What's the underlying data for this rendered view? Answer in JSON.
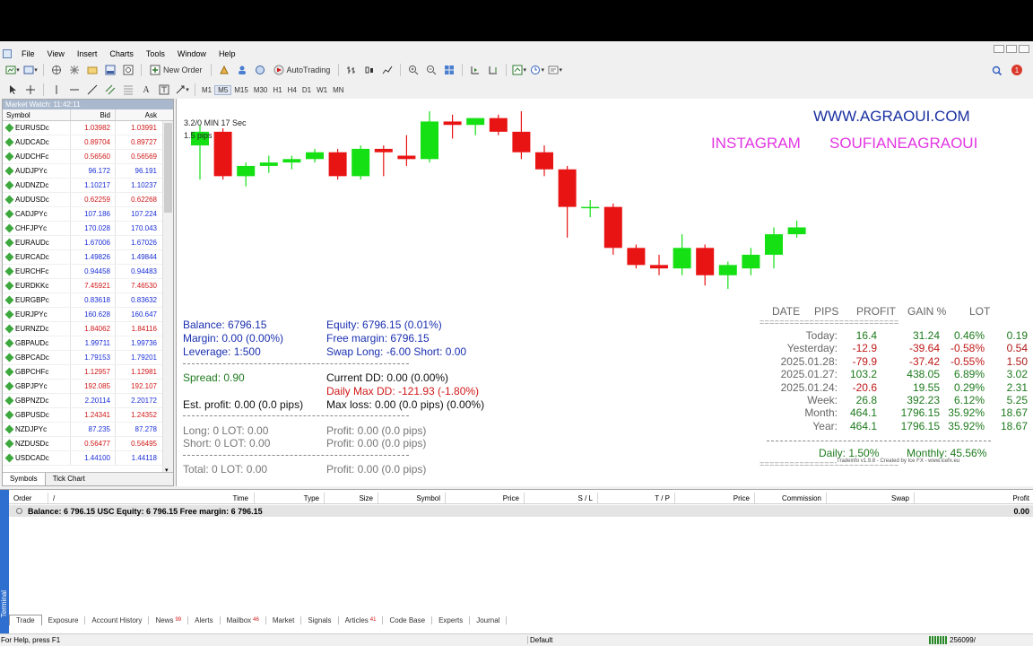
{
  "menu": [
    "File",
    "View",
    "Insert",
    "Charts",
    "Tools",
    "Window",
    "Help"
  ],
  "toolbar": {
    "new_order": "New Order",
    "auto_trading": "AutoTrading",
    "timeframes": [
      "M1",
      "M5",
      "M15",
      "M30",
      "H1",
      "H4",
      "D1",
      "W1",
      "MN"
    ],
    "notification_count": "1"
  },
  "market_watch": {
    "title": "Market Watch: 11:42:11",
    "headers": [
      "Symbol",
      "Bid",
      "Ask"
    ],
    "rows": [
      {
        "symbol": "EURUSDc",
        "bid": "1.03982",
        "ask": "1.03991",
        "dir": "up"
      },
      {
        "symbol": "AUDCADc",
        "bid": "0.89704",
        "ask": "0.89727",
        "dir": "up"
      },
      {
        "symbol": "AUDCHFc",
        "bid": "0.56560",
        "ask": "0.56569",
        "dir": "up"
      },
      {
        "symbol": "AUDJPYc",
        "bid": "96.172",
        "ask": "96.191",
        "dir": "dn"
      },
      {
        "symbol": "AUDNZDc",
        "bid": "1.10217",
        "ask": "1.10237",
        "dir": "dn"
      },
      {
        "symbol": "AUDUSDc",
        "bid": "0.62259",
        "ask": "0.62268",
        "dir": "up"
      },
      {
        "symbol": "CADJPYc",
        "bid": "107.186",
        "ask": "107.224",
        "dir": "dn"
      },
      {
        "symbol": "CHFJPYc",
        "bid": "170.028",
        "ask": "170.043",
        "dir": "dn"
      },
      {
        "symbol": "EURAUDc",
        "bid": "1.67006",
        "ask": "1.67026",
        "dir": "dn"
      },
      {
        "symbol": "EURCADc",
        "bid": "1.49826",
        "ask": "1.49844",
        "dir": "dn"
      },
      {
        "symbol": "EURCHFc",
        "bid": "0.94458",
        "ask": "0.94483",
        "dir": "dn"
      },
      {
        "symbol": "EURDKKc",
        "bid": "7.45921",
        "ask": "7.46530",
        "dir": "up"
      },
      {
        "symbol": "EURGBPc",
        "bid": "0.83618",
        "ask": "0.83632",
        "dir": "dn"
      },
      {
        "symbol": "EURJPYc",
        "bid": "160.628",
        "ask": "160.647",
        "dir": "dn"
      },
      {
        "symbol": "EURNZDc",
        "bid": "1.84062",
        "ask": "1.84116",
        "dir": "up"
      },
      {
        "symbol": "GBPAUDc",
        "bid": "1.99711",
        "ask": "1.99736",
        "dir": "dn"
      },
      {
        "symbol": "GBPCADc",
        "bid": "1.79153",
        "ask": "1.79201",
        "dir": "dn"
      },
      {
        "symbol": "GBPCHFc",
        "bid": "1.12957",
        "ask": "1.12981",
        "dir": "up"
      },
      {
        "symbol": "GBPJPYc",
        "bid": "192.085",
        "ask": "192.107",
        "dir": "up"
      },
      {
        "symbol": "GBPNZDc",
        "bid": "2.20114",
        "ask": "2.20172",
        "dir": "dn"
      },
      {
        "symbol": "GBPUSDc",
        "bid": "1.24341",
        "ask": "1.24352",
        "dir": "up"
      },
      {
        "symbol": "NZDJPYc",
        "bid": "87.235",
        "ask": "87.278",
        "dir": "dn"
      },
      {
        "symbol": "NZDUSDc",
        "bid": "0.56477",
        "ask": "0.56495",
        "dir": "up"
      },
      {
        "symbol": "USDCADc",
        "bid": "1.44100",
        "ask": "1.44118",
        "dir": "dn"
      }
    ],
    "tabs": [
      "Symbols",
      "Tick Chart"
    ]
  },
  "chart": {
    "timer_line1": "3.2/0 MIN 17 Sec",
    "timer_line2": "1.5 pips",
    "website": "WWW.AGRAOUI.COM",
    "instagram_label": "INSTAGRAM",
    "instagram_handle": "SOUFIANEAGRAOUI",
    "colors": {
      "bull": "#14e014",
      "bear": "#e81414"
    },
    "candles": [
      {
        "o": 1.0402,
        "h": 1.0408,
        "l": 1.0392,
        "c": 1.0406
      },
      {
        "o": 1.0406,
        "h": 1.0407,
        "l": 1.0392,
        "c": 1.0393
      },
      {
        "o": 1.0393,
        "h": 1.0397,
        "l": 1.039,
        "c": 1.0396
      },
      {
        "o": 1.0396,
        "h": 1.0399,
        "l": 1.0394,
        "c": 1.0397
      },
      {
        "o": 1.0397,
        "h": 1.0399,
        "l": 1.0395,
        "c": 1.0398
      },
      {
        "o": 1.0398,
        "h": 1.0401,
        "l": 1.0397,
        "c": 1.04
      },
      {
        "o": 1.04,
        "h": 1.0401,
        "l": 1.0392,
        "c": 1.0393
      },
      {
        "o": 1.0393,
        "h": 1.0402,
        "l": 1.0392,
        "c": 1.0401
      },
      {
        "o": 1.0401,
        "h": 1.0402,
        "l": 1.0393,
        "c": 1.04
      },
      {
        "o": 1.0399,
        "h": 1.0405,
        "l": 1.0396,
        "c": 1.0398
      },
      {
        "o": 1.0398,
        "h": 1.0412,
        "l": 1.0397,
        "c": 1.0409
      },
      {
        "o": 1.0409,
        "h": 1.0411,
        "l": 1.0404,
        "c": 1.0408
      },
      {
        "o": 1.0408,
        "h": 1.041,
        "l": 1.0405,
        "c": 1.041
      },
      {
        "o": 1.041,
        "h": 1.0411,
        "l": 1.0405,
        "c": 1.0406
      },
      {
        "o": 1.0406,
        "h": 1.0412,
        "l": 1.0398,
        "c": 1.04
      },
      {
        "o": 1.04,
        "h": 1.0402,
        "l": 1.0393,
        "c": 1.0395
      },
      {
        "o": 1.0395,
        "h": 1.0396,
        "l": 1.0375,
        "c": 1.0384
      },
      {
        "o": 1.0384,
        "h": 1.0386,
        "l": 1.0381,
        "c": 1.0384
      },
      {
        "o": 1.0384,
        "h": 1.0385,
        "l": 1.037,
        "c": 1.0372
      },
      {
        "o": 1.0372,
        "h": 1.0373,
        "l": 1.0366,
        "c": 1.0367
      },
      {
        "o": 1.0367,
        "h": 1.037,
        "l": 1.0364,
        "c": 1.0366
      },
      {
        "o": 1.0366,
        "h": 1.0376,
        "l": 1.0364,
        "c": 1.0372
      },
      {
        "o": 1.0372,
        "h": 1.0373,
        "l": 1.0361,
        "c": 1.0364
      },
      {
        "o": 1.0364,
        "h": 1.0368,
        "l": 1.036,
        "c": 1.0367
      },
      {
        "o": 1.0366,
        "h": 1.0372,
        "l": 1.0364,
        "c": 1.037
      },
      {
        "o": 1.037,
        "h": 1.0378,
        "l": 1.0366,
        "c": 1.0376
      },
      {
        "o": 1.0376,
        "h": 1.038,
        "l": 1.0375,
        "c": 1.0378
      }
    ],
    "account": {
      "balance": "Balance:  6796.15",
      "margin": "Margin: 0.00  (0.00%)",
      "leverage": "Leverage: 1:500",
      "equity": "Equity:  6796.15  (0.01%)",
      "free_margin": "Free margin: 6796.15",
      "swap": "Swap  Long: -6.00  Short: 0.00",
      "spread": "Spread: 0.90",
      "current_dd": "Current    DD: 0.00   (0.00%)",
      "daily_max_dd": "Daily Max DD: -121.93   (-1.80%)",
      "est_profit": "Est. profit: 0.00  (0.0 pips)",
      "max_loss": "Max loss:  0.00  (0.0 pips)  (0.00%)",
      "long": "Long:  0   LOT: 0.00",
      "short": "Short:  0   LOT: 0.00",
      "long_profit": "Profit: 0.00   (0.0 pips)",
      "short_profit": "Profit: 0.00   (0.0 pips)",
      "total": "Total:  0   LOT: 0.00",
      "total_profit": "Profit: 0.00   (0.0 pips)"
    },
    "stats": {
      "headers": [
        "DATE",
        "PIPS",
        "PROFIT",
        "GAIN %",
        "LOT"
      ],
      "separator": "============================",
      "rows": [
        {
          "date": "Today:",
          "pips": "16.4",
          "profit": "31.24",
          "gain": "0.46%",
          "lot": "0.19",
          "dir": "pos"
        },
        {
          "date": "Yesterday:",
          "pips": "-12.9",
          "profit": "-39.64",
          "gain": "-0.58%",
          "lot": "0.54",
          "dir": "neg"
        },
        {
          "date": "2025.01.28:",
          "pips": "-79.9",
          "profit": "-37.42",
          "gain": "-0.55%",
          "lot": "1.50",
          "dir": "neg"
        },
        {
          "date": "2025.01.27:",
          "pips": "103.2",
          "profit": "438.05",
          "gain": "6.89%",
          "lot": "3.02",
          "dir": "pos"
        },
        {
          "date": "2025.01.24:",
          "pips": "-20.6",
          "profit": "19.55",
          "gain": "0.29%",
          "lot": "2.31",
          "dir": "mix"
        },
        {
          "date": "Week:",
          "pips": "26.8",
          "profit": "392.23",
          "gain": "6.12%",
          "lot": "5.25",
          "dir": "pos"
        },
        {
          "date": "Month:",
          "pips": "464.1",
          "profit": "1796.15",
          "gain": "35.92%",
          "lot": "18.67",
          "dir": "pos"
        },
        {
          "date": "Year:",
          "pips": "464.1",
          "profit": "1796.15",
          "gain": "35.92%",
          "lot": "18.67",
          "dir": "pos"
        }
      ],
      "daily": "Daily: 1.50%",
      "monthly": "Monthly: 45.56%",
      "credit": "Tradeinfo v1.9.8 - Created by Ice FX - www.icefx.eu"
    }
  },
  "terminal": {
    "side_label": "Terminal",
    "columns": [
      "Order",
      "/",
      "Time",
      "Type",
      "Size",
      "Symbol",
      "Price",
      "S / L",
      "T / P",
      "Price",
      "Commission",
      "Swap",
      "Profit"
    ],
    "balance_line": "Balance: 6 796.15 USC  Equity: 6 796.15  Free margin: 6 796.15",
    "balance_profit": "0.00",
    "tabs": [
      {
        "label": "Trade",
        "badge": ""
      },
      {
        "label": "Exposure",
        "badge": ""
      },
      {
        "label": "Account History",
        "badge": ""
      },
      {
        "label": "News",
        "badge": "99"
      },
      {
        "label": "Alerts",
        "badge": ""
      },
      {
        "label": "Mailbox",
        "badge": "46"
      },
      {
        "label": "Market",
        "badge": ""
      },
      {
        "label": "Signals",
        "badge": ""
      },
      {
        "label": "Articles",
        "badge": "41"
      },
      {
        "label": "Code Base",
        "badge": ""
      },
      {
        "label": "Experts",
        "badge": ""
      },
      {
        "label": "Journal",
        "badge": ""
      }
    ]
  },
  "status": {
    "help": "For Help, press F1",
    "profile": "Default",
    "traffic": "256099/"
  }
}
